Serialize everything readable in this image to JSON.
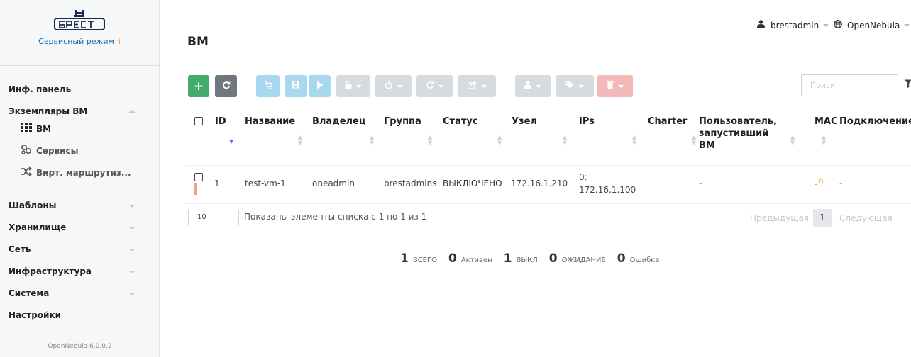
{
  "sidebar": {
    "service_mode": "Сервисный режим",
    "service_mode_info": "i",
    "version": "OpenNebula 6.0.0.2",
    "items": [
      {
        "label": "Инф. панель"
      },
      {
        "label": "Экземпляры ВМ"
      },
      {
        "label": "ВМ",
        "icon": "grid-icon"
      },
      {
        "label": "Сервисы",
        "icon": "services-icon"
      },
      {
        "label": "Вирт. маршрутиз...",
        "icon": "router-icon"
      },
      {
        "label": "Шаблоны"
      },
      {
        "label": "Хранилище"
      },
      {
        "label": "Сеть"
      },
      {
        "label": "Инфраструктура"
      },
      {
        "label": "Система"
      },
      {
        "label": "Настройки"
      }
    ]
  },
  "header": {
    "title": "ВМ",
    "user": "brestadmin",
    "zone": "OpenNebula"
  },
  "toolbar": {
    "search_placeholder": "Поиск",
    "colors": {
      "green": "#43ac6a",
      "gray": "#70777e",
      "blue": "#a8d8f0",
      "disabled": "#d7dade",
      "red": "#f3b8b8"
    }
  },
  "table": {
    "columns": [
      "ID",
      "Название",
      "Владелец",
      "Группа",
      "Статус",
      "Узел",
      "IPs",
      "Charter",
      "Пользователь,",
      "запустивший",
      "ВМ",
      "MAC",
      "Подключение"
    ],
    "rows": [
      {
        "id": "1",
        "name": "test-vm-1",
        "owner": "oneadmin",
        "group": "brestadmins",
        "status": "ВЫКЛЮЧЕНО",
        "host": "172.16.1.210",
        "ips_1": "0:",
        "ips_2": "172.16.1.100",
        "user": "-",
        "mac": "-",
        "mac_badge": "D",
        "connection": "-"
      }
    ],
    "page_size": "10",
    "info": "Показаны элементы списка с 1 по 1 из 1",
    "prev": "Предыдущая",
    "page": "1",
    "next": "Следующая"
  },
  "summary": [
    {
      "num": "1",
      "label": "ВСЕГО"
    },
    {
      "num": "0",
      "label": "Активен"
    },
    {
      "num": "1",
      "label": "ВЫКЛ"
    },
    {
      "num": "0",
      "label": "ОЖИДАНИЕ"
    },
    {
      "num": "0",
      "label": "Ошибка"
    }
  ]
}
